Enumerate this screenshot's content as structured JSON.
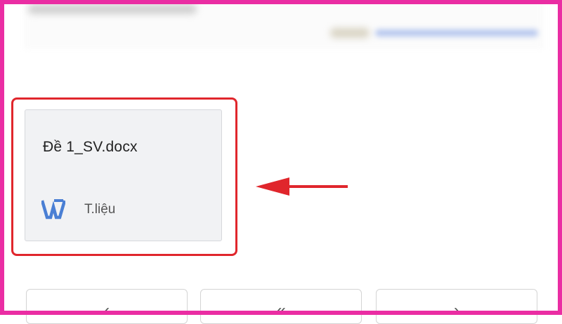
{
  "file": {
    "name": "Đề 1_SV.docx",
    "type_label": "T.liệu",
    "icon": "word-icon"
  },
  "colors": {
    "frame": "#ea2da3",
    "highlight": "#e0262c",
    "word_blue": "#4a7fd4",
    "card_bg": "#f1f2f4"
  },
  "bottom_nav": {
    "buttons": [
      {
        "label": "‹",
        "icon": "chevron-left-icon"
      },
      {
        "label": "«",
        "icon": "double-chevron-icon"
      },
      {
        "label": "›",
        "icon": "chevron-right-icon"
      }
    ]
  }
}
